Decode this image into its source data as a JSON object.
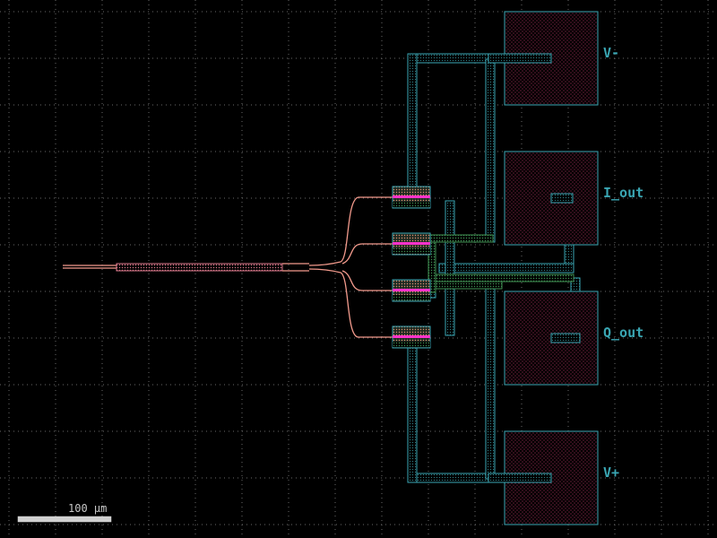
{
  "pads": [
    {
      "label": "V-"
    },
    {
      "label": "I_out"
    },
    {
      "label": "Q_out"
    },
    {
      "label": "V+"
    }
  ],
  "scale_bar": {
    "label": "100 μm"
  },
  "colors": {
    "background": "#000000",
    "grid_dot": "#6a6a6a",
    "metal_outline": "#3aa6b3",
    "pad_fill": "#6b1e3a",
    "waveguide": "#f29a8c",
    "doping_magenta": "#ff33cc",
    "via_green": "#3f8f52",
    "scale_bar": "#d0d0d0"
  },
  "icons": {
    "pad": "metal-bond-pad",
    "modulator": "photodiode-segment",
    "waveguide": "optical-waveguide"
  }
}
